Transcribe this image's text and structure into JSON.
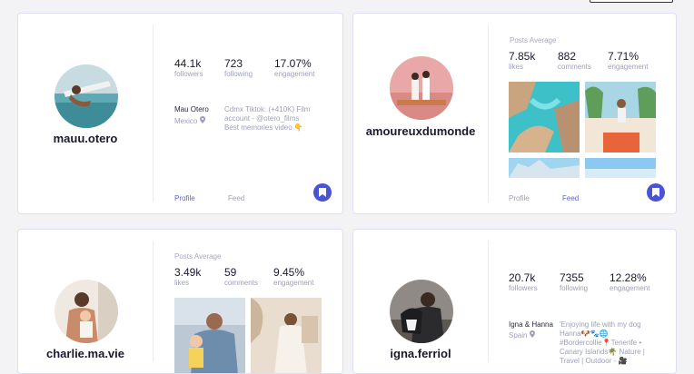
{
  "cards": [
    {
      "username": "mauu.otero",
      "stats": [
        {
          "value": "44.1k",
          "label": "followers"
        },
        {
          "value": "723",
          "label": "following"
        },
        {
          "value": "17.07%",
          "label": "engagement"
        }
      ],
      "owner_name": "Mau Otero",
      "location": "Mexico",
      "bio_lines": [
        "Cdmx Tiktok: (+410K) Film",
        "account - @otero_films",
        "Best memories video 👇"
      ],
      "tabs": {
        "profile": "Profile",
        "feed": "Feed",
        "active": "profile"
      }
    },
    {
      "username": "amoureuxdumonde",
      "section_title": "Posts Average",
      "stats": [
        {
          "value": "7.85k",
          "label": "likes"
        },
        {
          "value": "882",
          "label": "comments"
        },
        {
          "value": "7.71%",
          "label": "engagement"
        }
      ],
      "tabs": {
        "profile": "Profile",
        "feed": "Feed",
        "active": "feed"
      }
    },
    {
      "username": "charlie.ma.vie",
      "section_title": "Posts Average",
      "stats": [
        {
          "value": "3.49k",
          "label": "likes"
        },
        {
          "value": "59",
          "label": "comments"
        },
        {
          "value": "9.45%",
          "label": "engagement"
        }
      ]
    },
    {
      "username": "igna.ferriol",
      "stats": [
        {
          "value": "20.7k",
          "label": "followers"
        },
        {
          "value": "7355",
          "label": "following"
        },
        {
          "value": "12.28%",
          "label": "engagement"
        }
      ],
      "owner_name": "Igna & Hanna",
      "location": "Spain",
      "bio_lines": [
        "'Enjoying life with my dog",
        "Hanna🐶🐾🌐",
        "#Bordercollie📍Tenerife •",
        "Canary Islands🌴 Nature |",
        "Travel | Outdoor - 🎥"
      ]
    }
  ],
  "icons": {
    "location": "location-pin-icon",
    "save": "bookmark-icon"
  },
  "colors": {
    "accent": "#4a53d4",
    "tab_active": "#5c63d6",
    "muted": "#9da0b8",
    "border": "#dcdff5"
  }
}
